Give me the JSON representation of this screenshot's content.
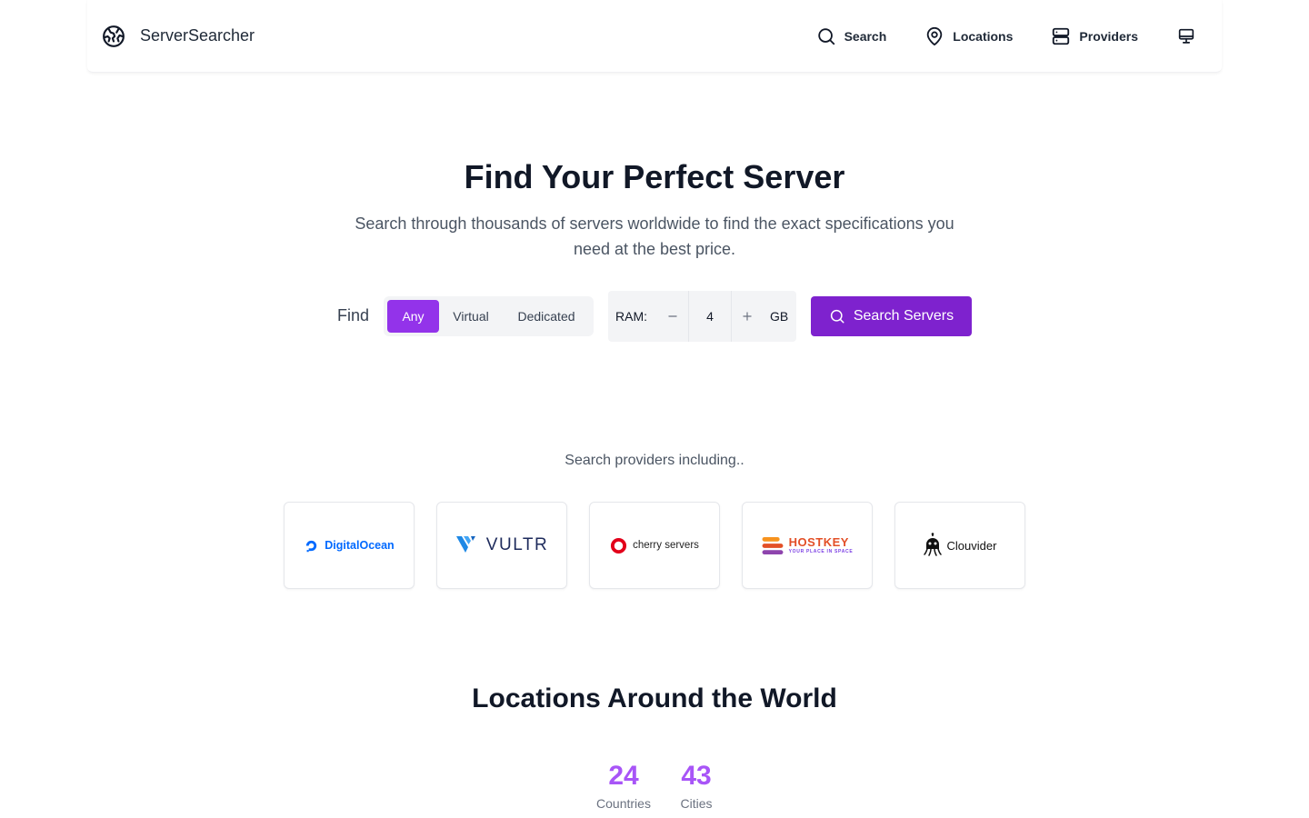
{
  "header": {
    "brand": "ServerSearcher",
    "nav": [
      {
        "label": "Search",
        "icon": "search-icon"
      },
      {
        "label": "Locations",
        "icon": "map-pin-icon"
      },
      {
        "label": "Providers",
        "icon": "server-icon"
      }
    ],
    "theme_icon": "monitor-icon"
  },
  "hero": {
    "title": "Find Your Perfect Server",
    "subtitle": "Search through thousands of servers worldwide to find the exact specifications you need at the best price."
  },
  "search": {
    "find_label": "Find",
    "types": [
      "Any",
      "Virtual",
      "Dedicated"
    ],
    "selected_type": "Any",
    "ram_label": "RAM:",
    "ram_value": "4",
    "ram_unit": "GB",
    "button_label": "Search Servers"
  },
  "providers": {
    "label": "Search providers including..",
    "items": [
      {
        "name": "DigitalOcean"
      },
      {
        "name": "VULTR"
      },
      {
        "name": "cherry servers"
      },
      {
        "name": "HOSTKEY",
        "tagline": "YOUR PLACE IN SPACE"
      },
      {
        "name": "Clouvider"
      }
    ]
  },
  "locations": {
    "title": "Locations Around the World",
    "stats": [
      {
        "value": "24",
        "label": "Countries"
      },
      {
        "value": "43",
        "label": "Cities"
      }
    ]
  },
  "colors": {
    "accent": "#9333ea",
    "button": "#7e22ce",
    "stat": "#a855f7"
  }
}
